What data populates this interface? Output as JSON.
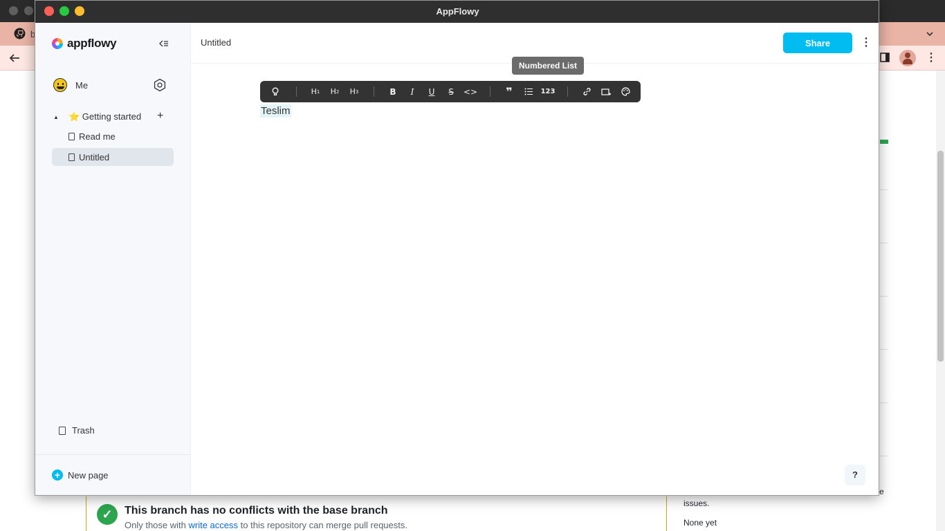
{
  "app": {
    "title": "AppFlowy",
    "brand": "appflowy"
  },
  "colors": {
    "accent": "#00bcf0",
    "close": "#ff5f57",
    "minimize": "#28c840",
    "maximize": "#febc2e"
  },
  "background": {
    "tab_title": "b",
    "merge_title": "This branch has no conflicts with the base branch",
    "merge_sub_prefix": "Only those with",
    "merge_sub_link": "write access",
    "merge_sub_suffix": "to this repository can merge pull requests.",
    "side_line1": "issues.",
    "side_line2": "None yet",
    "side_line0": "e"
  },
  "sidebar": {
    "user": {
      "name": "Me"
    },
    "folder": {
      "label": "⭐ Getting started"
    },
    "pages": [
      {
        "label": "Read me",
        "active": false
      },
      {
        "label": "Untitled",
        "active": true
      }
    ],
    "trash_label": "Trash",
    "new_page_label": "New page"
  },
  "header": {
    "breadcrumb": "Untitled",
    "share_label": "Share",
    "more_icon": "⋮"
  },
  "tooltip": {
    "text": "Numbered List"
  },
  "format_toolbar": {
    "items": [
      {
        "name": "tip-icon",
        "glyph": "💡"
      },
      {
        "name": "heading1-button",
        "glyph": "H1"
      },
      {
        "name": "heading2-button",
        "glyph": "H2"
      },
      {
        "name": "heading3-button",
        "glyph": "H3"
      },
      {
        "name": "bold-button",
        "glyph": "B"
      },
      {
        "name": "italic-button",
        "glyph": "I"
      },
      {
        "name": "underline-button",
        "glyph": "U"
      },
      {
        "name": "strikethrough-button",
        "glyph": "S"
      },
      {
        "name": "code-button",
        "glyph": "<>"
      },
      {
        "name": "quote-button",
        "glyph": "❞"
      },
      {
        "name": "bulleted-list-button",
        "glyph": "☰"
      },
      {
        "name": "numbered-list-button",
        "glyph": "123"
      },
      {
        "name": "link-button",
        "glyph": "🔗"
      },
      {
        "name": "highlight-button",
        "glyph": "▭"
      },
      {
        "name": "color-button",
        "glyph": "🎨"
      }
    ]
  },
  "document": {
    "text": "Teslim"
  },
  "help": {
    "label": "?"
  }
}
